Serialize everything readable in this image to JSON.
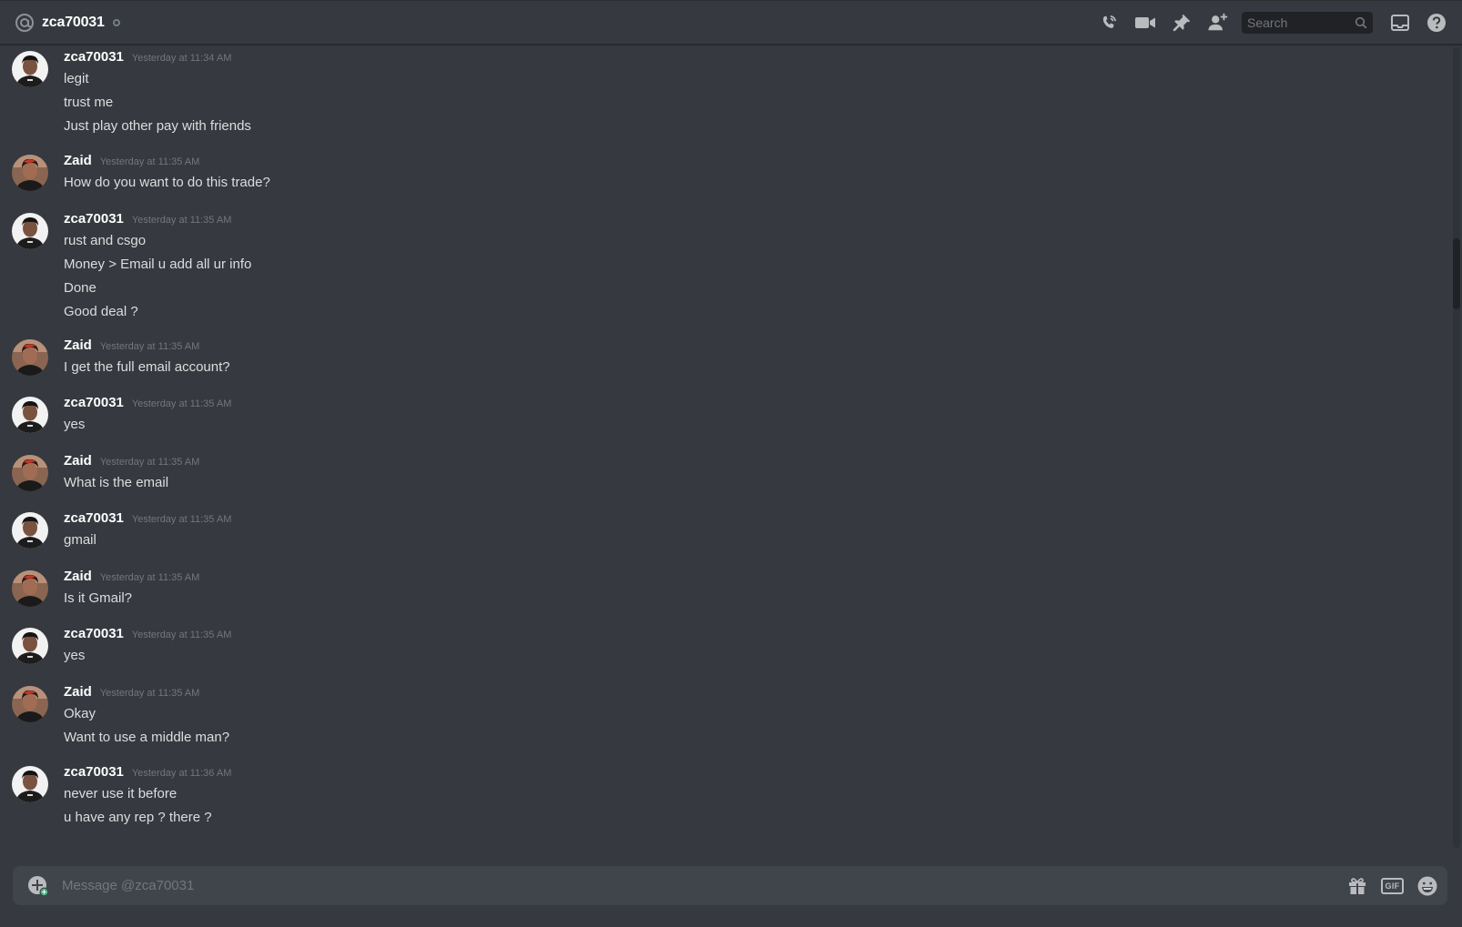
{
  "header": {
    "channel_name": "zca70031",
    "search_placeholder": "Search",
    "icons": [
      "at-icon",
      "status-offline-icon",
      "voice-call-icon",
      "video-call-icon",
      "pin-icon",
      "add-friend-icon",
      "search-icon",
      "inbox-icon",
      "help-icon"
    ]
  },
  "colors": {
    "background": "#36393f",
    "header_text": "#ffffff",
    "message_text": "#dcddde",
    "timestamp": "#72767d",
    "composer_bg": "#40444b",
    "search_bg": "#202225",
    "icon": "#b9bbbe"
  },
  "messages": [
    {
      "author": "zca70031",
      "avatar": "zca70031",
      "timestamp": "Yesterday at 11:34 AM",
      "lines": [
        "legit",
        "trust me",
        "Just play other pay with friends"
      ]
    },
    {
      "author": "Zaid",
      "avatar": "zaid",
      "timestamp": "Yesterday at 11:35 AM",
      "lines": [
        "How do you want to do this trade?"
      ]
    },
    {
      "author": "zca70031",
      "avatar": "zca70031",
      "timestamp": "Yesterday at 11:35 AM",
      "lines": [
        "rust and csgo",
        "Money > Email u add all ur info",
        "Done",
        "Good deal ?"
      ]
    },
    {
      "author": "Zaid",
      "avatar": "zaid",
      "timestamp": "Yesterday at 11:35 AM",
      "lines": [
        "I get the full email account?"
      ]
    },
    {
      "author": "zca70031",
      "avatar": "zca70031",
      "timestamp": "Yesterday at 11:35 AM",
      "lines": [
        "yes"
      ]
    },
    {
      "author": "Zaid",
      "avatar": "zaid",
      "timestamp": "Yesterday at 11:35 AM",
      "lines": [
        "What is the email"
      ]
    },
    {
      "author": "zca70031",
      "avatar": "zca70031",
      "timestamp": "Yesterday at 11:35 AM",
      "lines": [
        "gmail"
      ]
    },
    {
      "author": "Zaid",
      "avatar": "zaid",
      "timestamp": "Yesterday at 11:35 AM",
      "lines": [
        "Is it Gmail?"
      ]
    },
    {
      "author": "zca70031",
      "avatar": "zca70031",
      "timestamp": "Yesterday at 11:35 AM",
      "lines": [
        "yes"
      ]
    },
    {
      "author": "Zaid",
      "avatar": "zaid",
      "timestamp": "Yesterday at 11:35 AM",
      "lines": [
        "Okay",
        "Want to use a middle man?"
      ]
    },
    {
      "author": "zca70031",
      "avatar": "zca70031",
      "timestamp": "Yesterday at 11:36 AM",
      "lines": [
        "never use it before",
        "u have any rep ? there ?"
      ]
    }
  ],
  "composer": {
    "placeholder": "Message @zca70031",
    "gif_label": "GIF",
    "icons": [
      "attach-plus-icon",
      "gift-icon",
      "gif-icon",
      "emoji-icon"
    ]
  }
}
